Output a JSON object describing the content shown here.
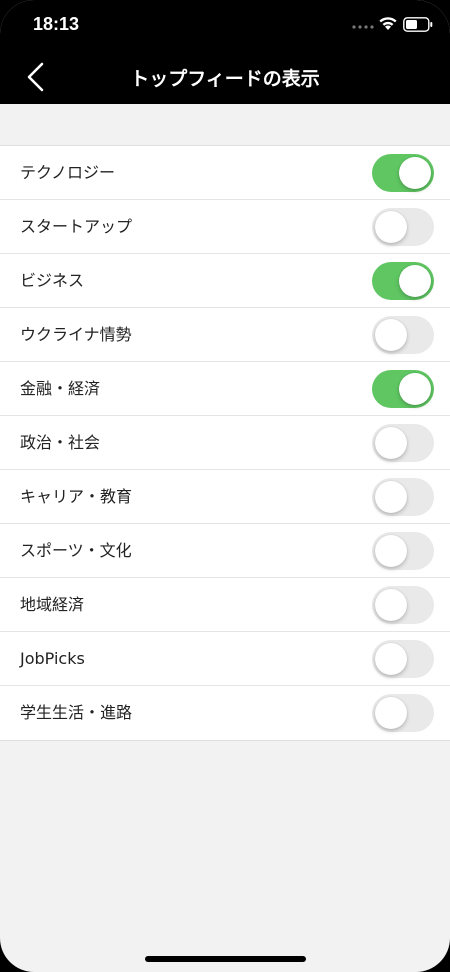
{
  "status_bar": {
    "time": "18:13",
    "icons": [
      "signal-dots-icon",
      "wifi-icon",
      "battery-icon"
    ]
  },
  "nav": {
    "back_icon": "chevron-left-icon",
    "title": "トップフィードの表示"
  },
  "colors": {
    "toggle_on": "#5fc662",
    "toggle_off": "#e9e9ea",
    "header_bg": "#000000",
    "page_bg": "#f2f2f2"
  },
  "settings": [
    {
      "label": "テクノロジー",
      "enabled": true
    },
    {
      "label": "スタートアップ",
      "enabled": false
    },
    {
      "label": "ビジネス",
      "enabled": true
    },
    {
      "label": "ウクライナ情勢",
      "enabled": false
    },
    {
      "label": "金融・経済",
      "enabled": true
    },
    {
      "label": "政治・社会",
      "enabled": false
    },
    {
      "label": "キャリア・教育",
      "enabled": false
    },
    {
      "label": "スポーツ・文化",
      "enabled": false
    },
    {
      "label": "地域経済",
      "enabled": false
    },
    {
      "label": "JobPicks",
      "enabled": false
    },
    {
      "label": "学生生活・進路",
      "enabled": false
    }
  ]
}
